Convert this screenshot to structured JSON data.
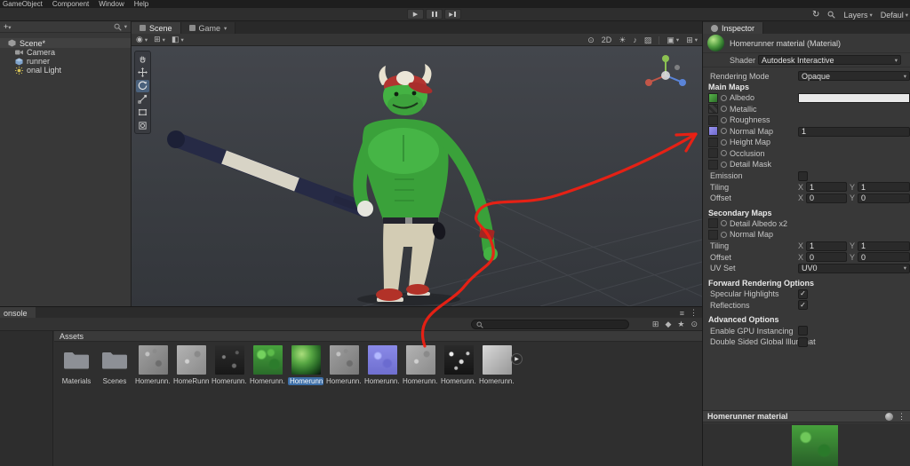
{
  "menu": {
    "items": [
      "GameObject",
      "Component",
      "Window",
      "Help"
    ]
  },
  "topbar": {
    "layers": "Layers",
    "layout": "Defaul"
  },
  "hierarchy": {
    "scene": "Scene*",
    "items": [
      {
        "label": "Camera"
      },
      {
        "label": "runner"
      },
      {
        "label": "onal Light"
      }
    ]
  },
  "scene_view": {
    "tab_scene": "Scene",
    "tab_game": "Game",
    "toggle_2d": "2D"
  },
  "console": {
    "tab": "onsole"
  },
  "project": {
    "header": "Assets",
    "search_placeholder": "",
    "selected_index": 6,
    "assets": [
      {
        "label": "Materials",
        "type": "folder"
      },
      {
        "label": "Scenes",
        "type": "folder"
      },
      {
        "label": "Homerunn...",
        "type": "texture"
      },
      {
        "label": "HomeRunn...",
        "type": "texture"
      },
      {
        "label": "Homerunn...",
        "type": "texture"
      },
      {
        "label": "Homerunn...",
        "type": "texture"
      },
      {
        "label": "Homerunn...",
        "type": "material"
      },
      {
        "label": "Homerunn...",
        "type": "texture"
      },
      {
        "label": "Homerunn...",
        "type": "normal-map"
      },
      {
        "label": "Homerunn...",
        "type": "texture"
      },
      {
        "label": "Homerunn...",
        "type": "texture"
      },
      {
        "label": "Homerunn...",
        "type": "model"
      }
    ]
  },
  "inspector": {
    "tab": "Inspector",
    "title": "Homerunner material (Material)",
    "shader_label": "Shader",
    "shader_value": "Autodesk Interactive",
    "rendering_mode_label": "Rendering Mode",
    "rendering_mode_value": "Opaque",
    "main_maps": "Main Maps",
    "albedo": "Albedo",
    "metallic": "Metallic",
    "roughness": "Roughness",
    "normal_map": "Normal Map",
    "normal_map_value": "1",
    "height_map": "Height Map",
    "occlusion": "Occlusion",
    "detail_mask": "Detail Mask",
    "emission": "Emission",
    "tiling": "Tiling",
    "offset": "Offset",
    "x_label": "X",
    "y_label": "Y",
    "main_tiling_x": "1",
    "main_tiling_y": "1",
    "main_offset_x": "0",
    "main_offset_y": "0",
    "secondary_maps": "Secondary Maps",
    "detail_albedo": "Detail Albedo x2",
    "secondary_normal_map": "Normal Map",
    "sec_tiling_x": "1",
    "sec_tiling_y": "1",
    "sec_offset_x": "0",
    "sec_offset_y": "0",
    "uv_set": "UV Set",
    "uv_set_value": "UV0",
    "forward_options": "Forward Rendering Options",
    "specular_highlights": "Specular Highlights",
    "reflections": "Reflections",
    "advanced_options": "Advanced Options",
    "gpu_instancing": "Enable GPU Instancing",
    "double_sided_gi": "Double Sided Global Illuminat",
    "preview_title": "Homerunner material"
  },
  "icons": {
    "caret_down": "▾",
    "kebab": "⋮",
    "menu": "≡",
    "sync": "↻",
    "check": "✓",
    "play": "▶",
    "star": "★",
    "grid": "⊞",
    "diamond": "◆",
    "circle": "⊙",
    "sphere": "◉",
    "note": "♪",
    "sun": "☀",
    "pattern": "▨",
    "frame": "▣",
    "half": "◧",
    "plus": "+"
  },
  "colors": {
    "selection_blue": "#3d6fa8",
    "annotation_red": "#ee2013",
    "albedo_green": "#3f9b3f",
    "normal_purple": "#8a84e6"
  }
}
